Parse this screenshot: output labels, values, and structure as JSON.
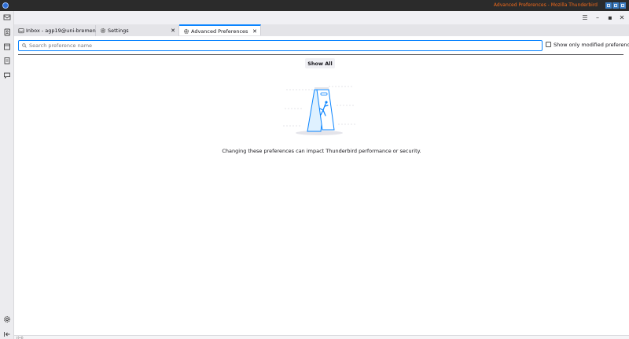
{
  "window": {
    "title": "Advanced Preferences - Mozilla Thunderbird"
  },
  "toolbar": {
    "menu_icon": "hamburger-menu-icon",
    "minimize_icon": "minimize-icon",
    "maximize_icon": "maximize-icon",
    "close_icon": "close-icon"
  },
  "spaces": [
    {
      "name": "mail",
      "icon": "mail-icon"
    },
    {
      "name": "address-book",
      "icon": "address-book-icon"
    },
    {
      "name": "calendar",
      "icon": "calendar-icon"
    },
    {
      "name": "tasks",
      "icon": "tasks-icon"
    },
    {
      "name": "chat",
      "icon": "chat-icon"
    }
  ],
  "spaces_bottom": [
    {
      "name": "settings",
      "icon": "gear-icon"
    },
    {
      "name": "collapse",
      "icon": "collapse-sidebar-icon"
    }
  ],
  "tabs": [
    {
      "label": "Inbox - agp19@uni-bremen.de",
      "icon": "inbox-icon",
      "active": false
    },
    {
      "label": "Settings",
      "icon": "gear-icon",
      "active": false
    },
    {
      "label": "Advanced Preferences",
      "icon": "gear-icon",
      "active": true
    }
  ],
  "search": {
    "placeholder": "Search preference name",
    "value": ""
  },
  "modified_checkbox": {
    "label": "Show only modified preferences",
    "checked": false
  },
  "show_all_button": "Show All",
  "warning_text": "Changing these preferences can impact Thunderbird performance or security.",
  "colors": {
    "accent": "#0a84ff",
    "title_text": "#f26a1b"
  }
}
